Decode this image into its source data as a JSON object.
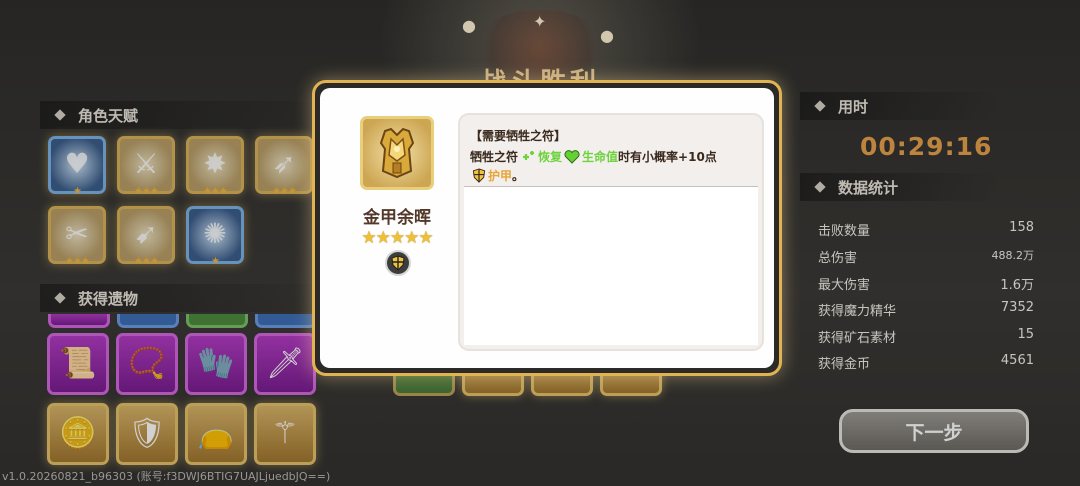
{
  "screen": {
    "title": "战斗胜利"
  },
  "left_panel": {
    "talents_header": "角色天赋",
    "talents": [
      {
        "name": "talent-heart-arrow",
        "stars": "★",
        "frame": "blue"
      },
      {
        "name": "talent-slash-1",
        "stars": "★★★",
        "frame": "gold"
      },
      {
        "name": "talent-burst",
        "stars": "★★★",
        "frame": "gold"
      },
      {
        "name": "talent-slash-2",
        "stars": "★★★",
        "frame": "gold"
      },
      {
        "name": "talent-wing",
        "stars": "★★★",
        "frame": "gold"
      },
      {
        "name": "talent-spear",
        "stars": "★★★",
        "frame": "gold"
      },
      {
        "name": "talent-vortex",
        "stars": "★",
        "frame": "blue"
      }
    ],
    "relics_header": "获得遗物",
    "relics": [
      {
        "name": "relic-scroll",
        "glyph": "📜",
        "frame": "purple"
      },
      {
        "name": "relic-necklace",
        "glyph": "📿",
        "frame": "purple"
      },
      {
        "name": "relic-gauntlet",
        "glyph": "🧤",
        "frame": "purple"
      },
      {
        "name": "relic-sword",
        "glyph": "🗡",
        "frame": "purple"
      },
      {
        "name": "relic-coin",
        "glyph": "🪙",
        "frame": "gold"
      },
      {
        "name": "relic-armor",
        "glyph": "🛡",
        "frame": "gold"
      },
      {
        "name": "relic-pouch",
        "glyph": "👝",
        "frame": "gold"
      },
      {
        "name": "relic-staff",
        "glyph": "⚚",
        "frame": "gold"
      }
    ]
  },
  "right_panel": {
    "time_header": "用时",
    "time_value": "00:29:16",
    "stats_header": "数据统计",
    "stats": [
      {
        "label": "击败数量",
        "value": "158"
      },
      {
        "label": "总伤害",
        "value": "488.2万"
      },
      {
        "label": "最大伤害",
        "value": "1.6万"
      },
      {
        "label": "获得魔力精华",
        "value": "7352"
      },
      {
        "label": "获得矿石素材",
        "value": "15"
      },
      {
        "label": "获得金币",
        "value": "4561"
      }
    ],
    "next_button": "下一步"
  },
  "version_text": "v1.0.20260821_b96303 (账号:f3DWJ6BTIG7UAJLjuedbJQ==)",
  "modal": {
    "item_name": "金甲余晖",
    "item_stars": "★★★★★",
    "item_icon": "golden-armor-icon",
    "badge_icon": "shield-badge-icon",
    "requirement": "【需要牺牲之符】",
    "desc_part1": "牺牲之符",
    "desc_heal": "恢复",
    "desc_hp": "生命值",
    "desc_part2": "时有小概率+10点",
    "desc_armor": "护甲",
    "desc_end": "。"
  },
  "colors": {
    "modal_border": "#e2b451",
    "time_value": "#e7a24b",
    "heal_green": "#6fd23f",
    "armor_orange": "#e7a53a",
    "relic_purple": "#b33cc4"
  }
}
